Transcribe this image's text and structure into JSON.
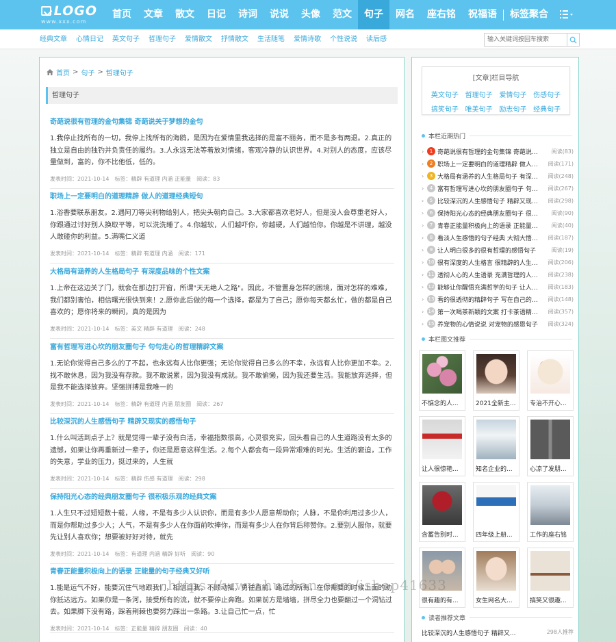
{
  "logo": {
    "main": "LOGO",
    "sub": "www.xxx.com"
  },
  "nav": {
    "items": [
      "首页",
      "文章",
      "散文",
      "日记",
      "诗词",
      "说说",
      "头像",
      "范文",
      "句子",
      "网名",
      "座右铭",
      "祝福语",
      "标签聚合"
    ],
    "active_index": 8,
    "menu_icon": "list-menu-icon"
  },
  "subnav": {
    "links": [
      "经典文章",
      "心情日记",
      "英文句子",
      "哲理句子",
      "爱情散文",
      "抒情散文",
      "生活随笔",
      "爱情诗歌",
      "个性说说",
      "读后感"
    ]
  },
  "search": {
    "placeholder": "输入关键词按回车搜索",
    "icon": "search-icon"
  },
  "breadcrumb": {
    "home": "首页",
    "level1": "句子",
    "level2": "哲理句子",
    "sep": ">"
  },
  "section_title": "哲理句子",
  "articles": [
    {
      "title": "奇葩说很有哲理的金句集锦 奇葩说关于梦想的金句",
      "summary": "1.我停止找所有的一切，我停上找所有的海鸥，是因为在爱情里我选择的是富不丽务，而不是多有两退。2.真正的独立是自由的独钓并负责任的履约。3.人永远无法等着放对情绪，客观冷静的认识世界。4.对别人的态度，应该尽量做到，富的，你不比他低，低的。",
      "meta": "发表时间：2021-10-14　标签：精辟 有道理 内涵 正能量　阅读：83"
    },
    {
      "title": "职场上一定要明白的道理精辟 做人的道理经典短句",
      "summary": "1.浴香要联系朋友。2.遇阿刀等尖利物给别人，把尖头朝向自己。3.大家都喜欢老好人，但是没人会尊重老好人，你跟通过讨好别人换取平等，可以洗洗睡了。4.你越软，人们越吓你，你越硬，人们越怕你。你越是不讲理，越没人敢碰你的利益。5.满嘴仁义道",
      "meta": "发表时间：2021-10-14　标签：精辟 有道理 内涵　阅读：171"
    },
    {
      "title": "大格局有涵养的人生格局句子 有深度品味的个性文案",
      "summary": "1.上帝在这边关了门，就会在那边打开窗，所谓\"天无绝人之路\"。因此，不管置身怎样的困境，面对怎样的难难，我们都别害怕，相信曙光很快到来！2.愿你此后做的每一个选择，都是为了自己；愿你每天都幺忙，做的都是自己喜欢的；愿你将来的瞬间，真的是因为",
      "meta": "发表时间：2021-10-14　标签：英文 精辟 有道理　阅读：248"
    },
    {
      "title": "富有哲理写进心坎的朋友圈句子 句句走心的哲理精辟文案",
      "summary": "1.无论你觉得自己多么的了不起，也永远有人比你更强；无论你觉得自己多么的不幸，永远有人比你更加不幸。2.找不敢休息，因为我没有存款。我不敢说累，因为我没有成就。我不敢偷懒，因为我还要生活。我能放弃选择，但是我不能选择放弃。坚强拼搏是我唯一的",
      "meta": "发表时间：2021-10-14　标签：精辟 有道理 内涵 朋友圈　阅读：267"
    },
    {
      "title": "比较深沉的人生感悟句子 精辟又现实的感悟句子",
      "summary": "1.什么叫活到点子上？就是觉得一辈子没有白活，幸福指数很高，心灵很充实，回头看自己的人生道路没有太多的遗憾，如果让你再重新过一辈子，你还是愿意这样生活。2.每个人都会有一段异常艰难的时光。生活的窘迫，工作的失意，学业的压力，挺过来的，人生就",
      "meta": "发表时间：2021-10-14　标签：精辟 伤感 有道理　阅读：298"
    },
    {
      "title": "保持阳光心态的经典朋友圈句子 很积极乐观的经典文案",
      "summary": "1.人生只不过短短数十载，人缘，不是有多少人认识你，而是有多少人愿意帮助你；人脉，不是你利用过多少人，而是你帮助过多少人；人气，不是有多少人在你面前吹捧你，而是有多少人在你背后称赞你。2.要别人服你，就要先让别人喜欢你；想要被好好对待，就先",
      "meta": "发表时间：2021-10-14　标签：有道理 内涵 精辟 好听　阅读：90"
    },
    {
      "title": "青春正能量积极向上的语录 正能量的句子经典又好听",
      "summary": "1.能是运气不好，能要沉住气地跟我们，相信自我，不顾动摇，勇往直前，路过的所有，在你需要的时候上面的助你抵达远方。如果你是一条河，接受所有的流，就不要停止奔跑。如果前方是墙墙，拼尽全力也要翻过一个洞钻过去。如果脚下没有路，踩着荆棘也要努力踩出一条路。3.让自己忙一点，忙",
      "meta": "发表时间：2021-10-14　标签：正能量 精辟 朋友圈　阅读：40"
    }
  ],
  "sidebar": {
    "cat_title": "[文章]栏目导航",
    "categories": [
      "英文句子",
      "哲理句子",
      "爱情句子",
      "伤感句子",
      "搞笑句子",
      "唯美句子",
      "励志句子",
      "经典句子"
    ],
    "hot_title": "本栏近期热门",
    "hot": [
      {
        "title": "奇葩说很有哲理的金句集锦 奇葩说关于梦想的金句",
        "count": "阅读(83)"
      },
      {
        "title": "职场上一定要明白的道理精辟 做人的道理经典短句",
        "count": "阅读(171)"
      },
      {
        "title": "大格局有涵养的人生格局句子 有深度品味的个性文案",
        "count": "阅读(248)"
      },
      {
        "title": "富有哲理写进心坎的朋友圈句子 句句走心的哲理精辟文案",
        "count": "阅读(267)"
      },
      {
        "title": "比较深沉的人生感悟句子 精辟又现实的感悟句子",
        "count": "阅读(298)"
      },
      {
        "title": "保持阳光心态的经典朋友圈句子 很积极乐观的经典文案",
        "count": "阅读(90)"
      },
      {
        "title": "青春正能量积极向上的语录 正能量的句子经典又好听",
        "count": "阅读(40)"
      },
      {
        "title": "看淡人生感悟的句子经典 大彻大悟看透人生的句子",
        "count": "阅读(187)"
      },
      {
        "title": "让人明白很多的很有哲理的感悟句子",
        "count": "阅读(19)"
      },
      {
        "title": "很有深度的人生格言 很精辟的人生格言",
        "count": "阅读(206)"
      },
      {
        "title": "透彻人心的人生语录 充满哲理的人生语录",
        "count": "阅读(238)"
      },
      {
        "title": "能够让你醒悟充满哲学的句子 让人醒悟的句子",
        "count": "阅读(183)"
      },
      {
        "title": "看的很透彻的精辟句子 写在自己的心里",
        "count": "阅读(148)"
      },
      {
        "title": "第一次喝茶新颖的文案 打卡茶语精辟句子",
        "count": "阅读(357)"
      },
      {
        "title": "养宠物的心情说说 对宠物的感恩句子",
        "count": "阅读(324)"
      }
    ],
    "pic_title": "本栏图文推荐",
    "pics": [
      {
        "caption": "不惦念的人...",
        "img": "flowers-image"
      },
      {
        "caption": "2021全新主...",
        "img": "girl-portrait-image"
      },
      {
        "caption": "专治不开心...",
        "img": "cartoon-image"
      },
      {
        "caption": "让人很惊艳...",
        "img": "love-board-image"
      },
      {
        "caption": "知名企业的...",
        "img": "office-hall-image"
      },
      {
        "caption": "心凉了发朋...",
        "img": "window-image"
      },
      {
        "caption": "含蓄告别时...",
        "img": "rose-image"
      },
      {
        "caption": "四年级上册...",
        "img": "work-plan-image"
      },
      {
        "caption": "工作的座右铭",
        "img": "business-people-image"
      },
      {
        "caption": "很有趣的有...",
        "img": "couple-image"
      },
      {
        "caption": "女生网名大...",
        "img": "smiling-girl-image"
      },
      {
        "caption": "搞笑又很趣...",
        "img": "table-chairs-image"
      }
    ],
    "rec_title": "读者推荐文章",
    "rec": [
      {
        "title": "比较深沉的人生感悟句子 精辟又...",
        "count": "298人推荐"
      }
    ]
  },
  "watermark": "https://www.huzhan.com/ishop41633",
  "colors": {
    "accent": "#5bc3ee",
    "link": "#39a9dc",
    "border": "#8fd6cf"
  }
}
